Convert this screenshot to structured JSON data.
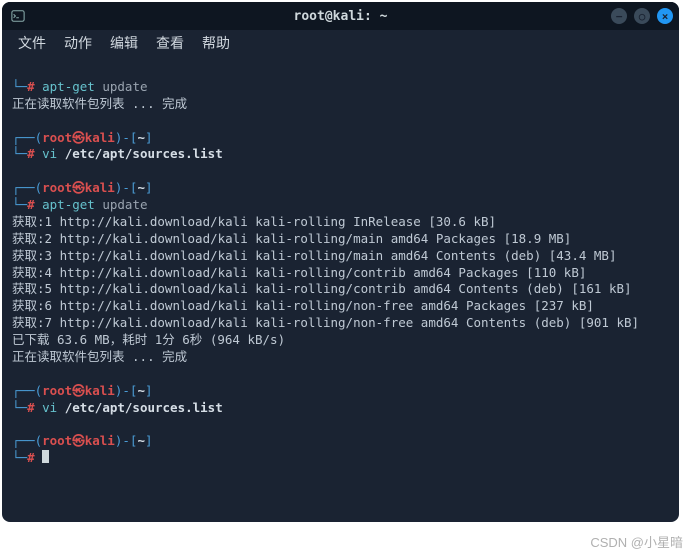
{
  "titlebar": {
    "title": "root@kali: ~"
  },
  "menu": {
    "file": "文件",
    "actions": "动作",
    "edit": "编辑",
    "view": "查看",
    "help": "帮助"
  },
  "prompt": {
    "user": "root",
    "at": "㉿",
    "host": "kali",
    "pathstart": "-[",
    "path": "~",
    "pathend": "]",
    "openL": "┌──(",
    "closeL": ")",
    "line2prefix": "└─",
    "hash": "#"
  },
  "cmds": {
    "cmd1_hash": "#",
    "cmd1": " apt-get",
    "cmd1_arg": " update",
    "cmd2": " vi",
    "cmd2_arg": " /etc/apt/sources.list",
    "cmd3": " apt-get",
    "cmd3_arg": " update",
    "cmd4": " vi",
    "cmd4_arg": " /etc/apt/sources.list"
  },
  "out": {
    "reading1": "正在读取软件包列表 ... 完成",
    "l1": "获取:1 http://kali.download/kali kali-rolling InRelease [30.6 kB]",
    "l2": "获取:2 http://kali.download/kali kali-rolling/main amd64 Packages [18.9 MB]",
    "l3": "获取:3 http://kali.download/kali kali-rolling/main amd64 Contents (deb) [43.4 MB]",
    "l4": "获取:4 http://kali.download/kali kali-rolling/contrib amd64 Packages [110 kB]",
    "l5": "获取:5 http://kali.download/kali kali-rolling/contrib amd64 Contents (deb) [161 kB]",
    "l6": "获取:6 http://kali.download/kali kali-rolling/non-free amd64 Packages [237 kB]",
    "l7": "获取:7 http://kali.download/kali kali-rolling/non-free amd64 Contents (deb) [901 kB]",
    "downloaded": "已下载 63.6 MB，耗时 1分 6秒 (964 kB/s)",
    "reading2": "正在读取软件包列表 ... 完成"
  },
  "watermark": "CSDN @小星暗"
}
